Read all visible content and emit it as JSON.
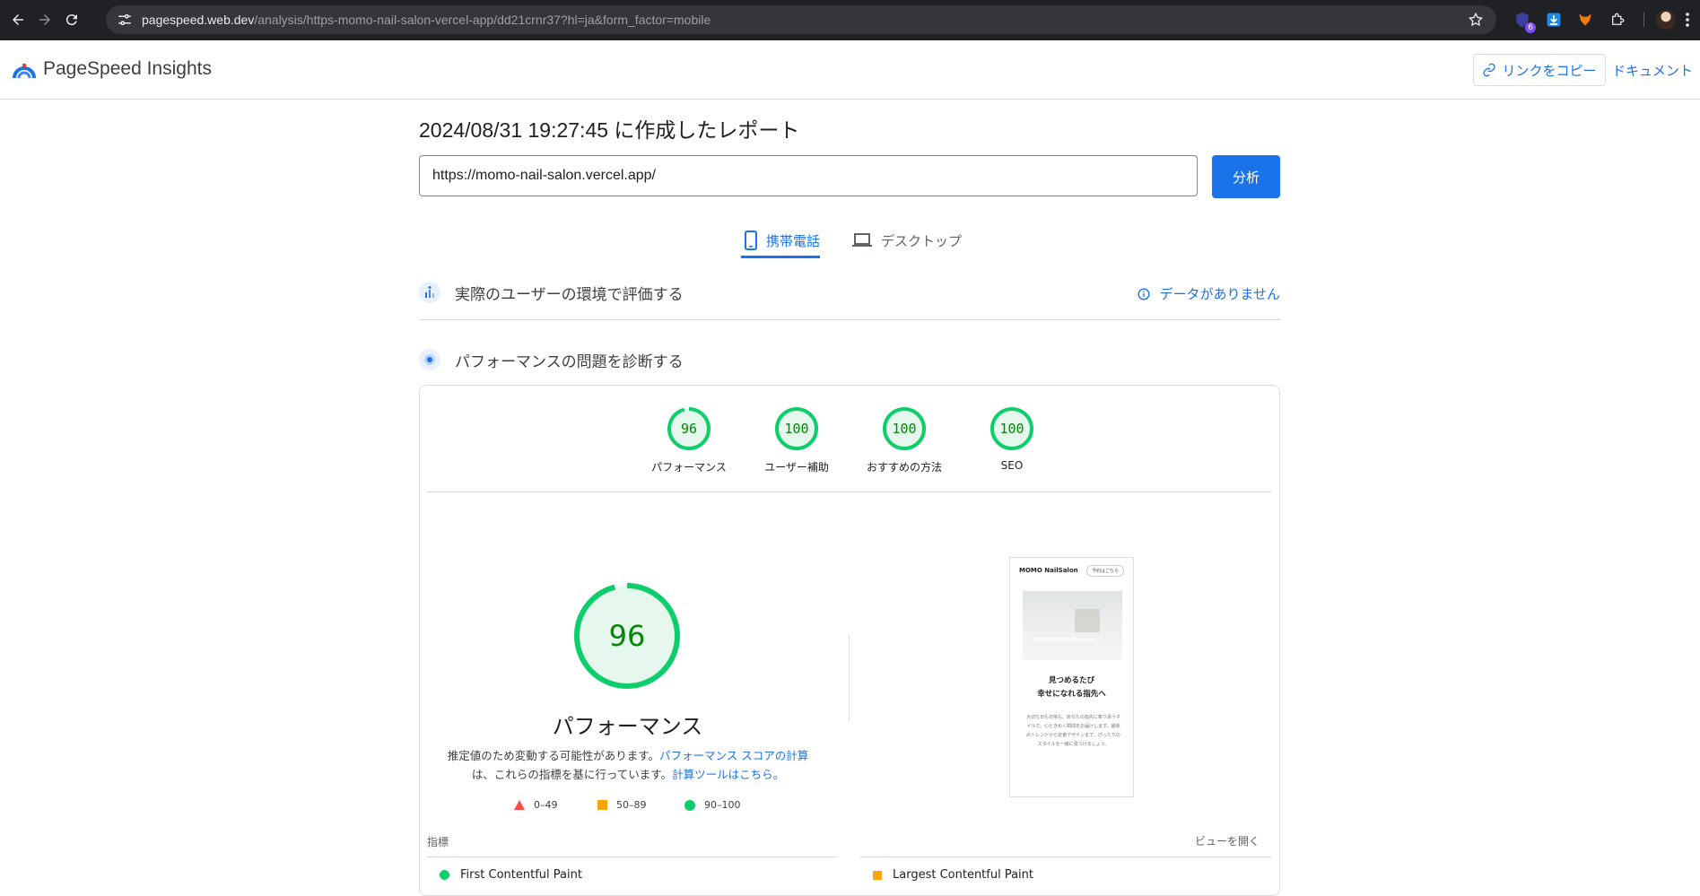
{
  "browser": {
    "url_host": "pagespeed.web.dev",
    "url_path": "/analysis/https-momo-nail-salon-vercel-app/dd21crnr37?hl=ja&form_factor=mobile",
    "extension_badge": "6"
  },
  "header": {
    "brand": "PageSpeed Insights",
    "copy_link_label": "リンクをコピー",
    "docs_label": "ドキュメント"
  },
  "report": {
    "title": "2024/08/31 19:27:45 に作成したレポート",
    "url_value": "https://momo-nail-salon.vercel.app/",
    "analyze_label": "分析"
  },
  "tabs": [
    {
      "label": "携帯電話",
      "active": true
    },
    {
      "label": "デスクトップ",
      "active": false
    }
  ],
  "field_section": {
    "title": "実際のユーザーの環境で評価する",
    "no_data_label": "データがありません"
  },
  "lab_section": {
    "title": "パフォーマンスの問題を診断する"
  },
  "scores": [
    {
      "value": 96,
      "label": "パフォーマンス"
    },
    {
      "value": 100,
      "label": "ユーザー補助"
    },
    {
      "value": 100,
      "label": "おすすめの方法"
    },
    {
      "value": 100,
      "label": "SEO"
    }
  ],
  "performance": {
    "score": 96,
    "label": "パフォーマンス",
    "desc_1": "推定値のため変動する可能性があります。",
    "desc_link_1": "パフォーマンス スコアの計算",
    "desc_2": "は、これらの指標を基に行っています。",
    "desc_link_2": "計算ツールはこちら。"
  },
  "legend": [
    {
      "range": "0–49",
      "color": "#ff4e42"
    },
    {
      "range": "50–89",
      "color": "#ffa400"
    },
    {
      "range": "90–100",
      "color": "#0cce6b"
    }
  ],
  "screenshot": {
    "site_name": "MOMO NailSalon",
    "button": "予約はこちら",
    "headline_1": "見つめるたび",
    "headline_2": "幸せになれる指先へ",
    "body": "大切な日も日常も、あなたの指先に寄り添うネイルで、心ときめく瞬間をお届けします。最新のトレンドから定番デザインまで、ぴったりのスタイルを一緒に見つけましょう。"
  },
  "metrics": {
    "label": "指標",
    "open_view": "ビューを開く",
    "items": [
      {
        "name": "First Contentful Paint",
        "status": "good"
      },
      {
        "name": "Largest Contentful Paint",
        "status": "average"
      }
    ]
  },
  "colors": {
    "accent": "#1a73e8",
    "good": "#0cce6b",
    "good_bg": "#e6f8ee",
    "good_text": "#008800"
  }
}
